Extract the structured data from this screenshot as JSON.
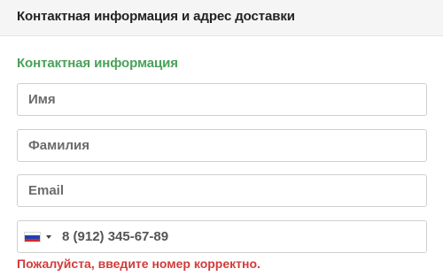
{
  "header": {
    "title": "Контактная информация и адрес доставки"
  },
  "section": {
    "title": "Контактная информация"
  },
  "fields": {
    "first_name": {
      "placeholder": "Имя",
      "value": ""
    },
    "last_name": {
      "placeholder": "Фамилия",
      "value": ""
    },
    "email": {
      "placeholder": "Email",
      "value": ""
    },
    "phone": {
      "country_flag_icon": "russia-flag-icon",
      "value": "8 (912) 345-67-89"
    }
  },
  "validation": {
    "phone_error": "Пожалуйста, введите номер корректно."
  },
  "colors": {
    "accent_green": "#4aa15a",
    "error_red": "#d23b3b",
    "header_bg": "#f5f5f5"
  }
}
